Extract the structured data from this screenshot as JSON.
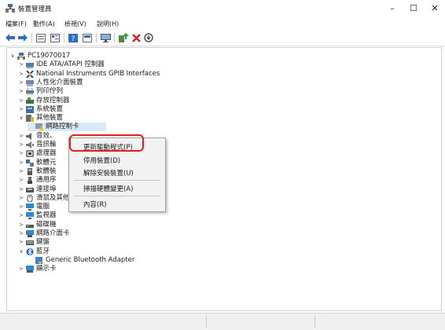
{
  "window": {
    "title": "裝置管理員",
    "minimize": "–",
    "maximize": "☐",
    "close": "✕"
  },
  "menubar": [
    "檔案(F)",
    "動作(A)",
    "檢視(V)",
    "說明(H)"
  ],
  "toolbar": [
    "back-icon",
    "forward-icon",
    "properties-icon",
    "view-icon",
    "help-icon",
    "refresh-icon",
    "monitor-icon",
    "update-driver-icon",
    "uninstall-icon",
    "disable-icon"
  ],
  "tree": [
    {
      "label": "PC19070017",
      "chevron": "∨",
      "icon": "computer-icon",
      "level": 0
    },
    {
      "label": "IDE ATA/ATAPI 控制器",
      "chevron": ">",
      "icon": "ide-icon",
      "level": 1
    },
    {
      "label": "National Instruments GPIB Interfaces",
      "chevron": ">",
      "icon": "gpib-icon",
      "level": 1
    },
    {
      "label": "人性化介面裝置",
      "chevron": ">",
      "icon": "hid-icon",
      "level": 1
    },
    {
      "label": "列印佇列",
      "chevron": ">",
      "icon": "printer-icon",
      "level": 1
    },
    {
      "label": "存放控制器",
      "chevron": ">",
      "icon": "storage-icon",
      "level": 1
    },
    {
      "label": "系統裝置",
      "chevron": ">",
      "icon": "system-icon",
      "level": 1
    },
    {
      "label": "其他裝置",
      "chevron": "∨",
      "icon": "other-device-icon",
      "level": 1
    },
    {
      "label": "網路控制卡",
      "chevron": "",
      "icon": "warning-device-icon",
      "level": 2,
      "selected": true
    },
    {
      "label": "音效、",
      "chevron": ">",
      "icon": "audio-icon",
      "level": 1
    },
    {
      "label": "音訊輸",
      "chevron": ">",
      "icon": "audio-io-icon",
      "level": 1
    },
    {
      "label": "處理器",
      "chevron": ">",
      "icon": "processor-icon",
      "level": 1
    },
    {
      "label": "軟體元",
      "chevron": ">",
      "icon": "software-component-icon",
      "level": 1
    },
    {
      "label": "軟體裝",
      "chevron": ">",
      "icon": "software-device-icon",
      "level": 1
    },
    {
      "label": "通用序",
      "chevron": ">",
      "icon": "usb-icon",
      "level": 1
    },
    {
      "label": "連接埠",
      "chevron": ">",
      "icon": "port-icon",
      "level": 1
    },
    {
      "label": "滑鼠及其他指標裝置",
      "chevron": ">",
      "icon": "mouse-icon",
      "level": 1
    },
    {
      "label": "電腦",
      "chevron": ">",
      "icon": "pc-icon",
      "level": 1
    },
    {
      "label": "監視器",
      "chevron": ">",
      "icon": "monitor-device-icon",
      "level": 1
    },
    {
      "label": "磁碟機",
      "chevron": ">",
      "icon": "disk-icon",
      "level": 1
    },
    {
      "label": "網路介面卡",
      "chevron": ">",
      "icon": "network-adapter-icon",
      "level": 1
    },
    {
      "label": "鍵盤",
      "chevron": ">",
      "icon": "keyboard-icon",
      "level": 1
    },
    {
      "label": "藍牙",
      "chevron": "∨",
      "icon": "bluetooth-icon",
      "level": 1
    },
    {
      "label": "Generic Bluetooth Adapter",
      "chevron": "",
      "icon": "bluetooth-adapter-icon",
      "level": 2
    },
    {
      "label": "顯示卡",
      "chevron": ">",
      "icon": "display-adapter-icon",
      "level": 1
    }
  ],
  "context_menu": {
    "items": [
      "更新驅動程式(P)",
      "停用裝置(D)",
      "解除安裝裝置(U)",
      "掃描硬體變更(A)",
      "內容(R)"
    ],
    "highlighted": "更新驅動程式(P)",
    "highlight_color": "#e02020"
  },
  "colors": {
    "accent": "#0a64c8",
    "selection": "#dbe9f7"
  }
}
